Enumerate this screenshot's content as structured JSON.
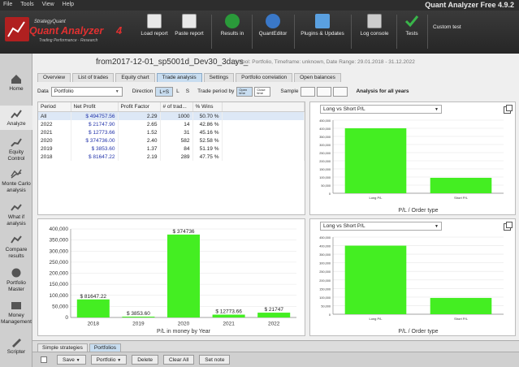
{
  "app": {
    "title": "Quant Analyzer Free 4.9.2",
    "menu": [
      "File",
      "Tools",
      "View",
      "Help"
    ]
  },
  "logo": {
    "top": "StrategyQuant",
    "name": "Quant Analyzer",
    "version": "4",
    "tag": "Trading Performance · Research"
  },
  "toolbar": [
    {
      "label": "Load report",
      "icon": "folder-icon",
      "color": "#e8e8e8"
    },
    {
      "label": "Paste report",
      "icon": "clipboard-icon",
      "color": "#e8e8e8"
    },
    {
      "label": "Results in",
      "icon": "dollar-icon",
      "color": "#2a9a3a"
    },
    {
      "label": "QuantEditor",
      "icon": "globe-icon",
      "color": "#3a78c8"
    },
    {
      "label": "Plugins & Updates",
      "icon": "plugins-icon",
      "color": "#5aa0e0"
    },
    {
      "label": "Log console",
      "icon": "console-icon",
      "color": "#cccccc"
    },
    {
      "label": "Tests",
      "icon": "check-icon",
      "color": "#39b54a"
    },
    {
      "label": "Custom test",
      "icon": "",
      "color": ""
    }
  ],
  "sidebar": [
    {
      "label": "Home",
      "icon": "home-icon"
    },
    {
      "label": "Analyze",
      "icon": "analyze-icon"
    },
    {
      "label": "Equity Control",
      "icon": "equity-control-icon"
    },
    {
      "label": "Monte Carlo analysis",
      "icon": "monte-carlo-icon"
    },
    {
      "label": "What if analysis",
      "icon": "what-if-icon"
    },
    {
      "label": "Compare results",
      "icon": "compare-icon"
    },
    {
      "label": "Portfolio Master",
      "icon": "portfolio-master-icon"
    },
    {
      "label": "Money Management",
      "icon": "money-management-icon"
    },
    {
      "label": "Scripter",
      "icon": "scripter-icon"
    }
  ],
  "main": {
    "heading": "from2017-12-01_sp5001d_Dev30_3days_",
    "subheading": "Symbol: Portfolio, Timeframe: unknown, Date Range: 29.01.2018 - 31.12.2022",
    "tabs": [
      "Overview",
      "List of trades",
      "Equity chart",
      "Trade analysis",
      "Settings",
      "Portfolio correlation",
      "Open balances"
    ],
    "active_tab": "Trade analysis"
  },
  "controls": {
    "data_label": "Data",
    "data_value": "Portfolio",
    "direction_label": "Direction",
    "direction_options": [
      "L+S",
      "L",
      "S"
    ],
    "period_label": "Trade period by",
    "period_options": [
      "Open time",
      "Close time"
    ],
    "sample_label": "Sample",
    "analysis_title": "Analysis for all years"
  },
  "table": {
    "headers": [
      "Period",
      "Net Profit",
      "Profit Factor",
      "# of trad...",
      "% Wins"
    ],
    "rows": [
      [
        "All",
        "$ 494757.56",
        "2.29",
        "1000",
        "50.70 %"
      ],
      [
        "2022",
        "$ 21747.90",
        "2.65",
        "14",
        "42.86 %"
      ],
      [
        "2021",
        "$ 12773.66",
        "1.52",
        "31",
        "45.16 %"
      ],
      [
        "2020",
        "$ 374736.00",
        "2.40",
        "582",
        "52.58 %"
      ],
      [
        "2019",
        "$ 3853.60",
        "1.37",
        "84",
        "51.19 %"
      ],
      [
        "2018",
        "$ 81647.22",
        "2.19",
        "289",
        "47.75 %"
      ]
    ]
  },
  "charts": {
    "top_select": "Long vs Short P/L",
    "bottom_select": "Long vs Short P/L",
    "top_caption": "P/L / Order type",
    "bottom_caption": "P/L / Order type",
    "year_caption": "P/L in money by Year"
  },
  "chart_data": [
    {
      "type": "bar",
      "categories": [
        "2018",
        "2019",
        "2020",
        "2021",
        "2022"
      ],
      "values": [
        81647.22,
        3853.6,
        374736,
        12773.66,
        21747
      ],
      "data_labels": [
        "$ 81647.22",
        "$ 3853.60",
        "$ 374736",
        "$ 12773.66",
        "$ 21747"
      ],
      "xlabel": "P/L in money by Year",
      "ylim": [
        0,
        400000
      ],
      "yticks": [
        0,
        50000,
        100000,
        150000,
        200000,
        250000,
        300000,
        350000,
        400000
      ],
      "ytick_labels": [
        "0",
        "50,000",
        "100,000",
        "150,000",
        "200,000",
        "250,000",
        "300,000",
        "350,000",
        "400,000"
      ],
      "color": "#44ee22"
    },
    {
      "type": "bar",
      "categories": [
        "Long P/L",
        "Short P/L"
      ],
      "values": [
        400000,
        95000
      ],
      "xlabel": "P/L / Order type",
      "ylim": [
        0,
        450000
      ],
      "yticks": [
        0,
        50000,
        100000,
        150000,
        200000,
        250000,
        300000,
        350000,
        400000,
        450000
      ],
      "ytick_labels": [
        "0",
        "50,000",
        "100,000",
        "150,000",
        "200,000",
        "250,000",
        "300,000",
        "350,000",
        "400,000",
        "450,000"
      ],
      "color": "#44ee22"
    },
    {
      "type": "bar",
      "categories": [
        "Long P/L",
        "Short P/L"
      ],
      "values": [
        400000,
        95000
      ],
      "xlabel": "P/L / Order type",
      "ylim": [
        0,
        450000
      ],
      "yticks": [
        0,
        50000,
        100000,
        150000,
        200000,
        250000,
        300000,
        350000,
        400000,
        450000
      ],
      "ytick_labels": [
        "0",
        "50,000",
        "100,000",
        "150,000",
        "200,000",
        "250,000",
        "300,000",
        "350,000",
        "400,000",
        "450,000"
      ],
      "color": "#44ee22"
    }
  ],
  "bottom": {
    "tabs": [
      "Simple strategies",
      "Portfolios"
    ],
    "active_tab": "Portfolios",
    "buttons": [
      "Save",
      "Portfolio",
      "Delete",
      "Clear All",
      "Set note"
    ]
  }
}
